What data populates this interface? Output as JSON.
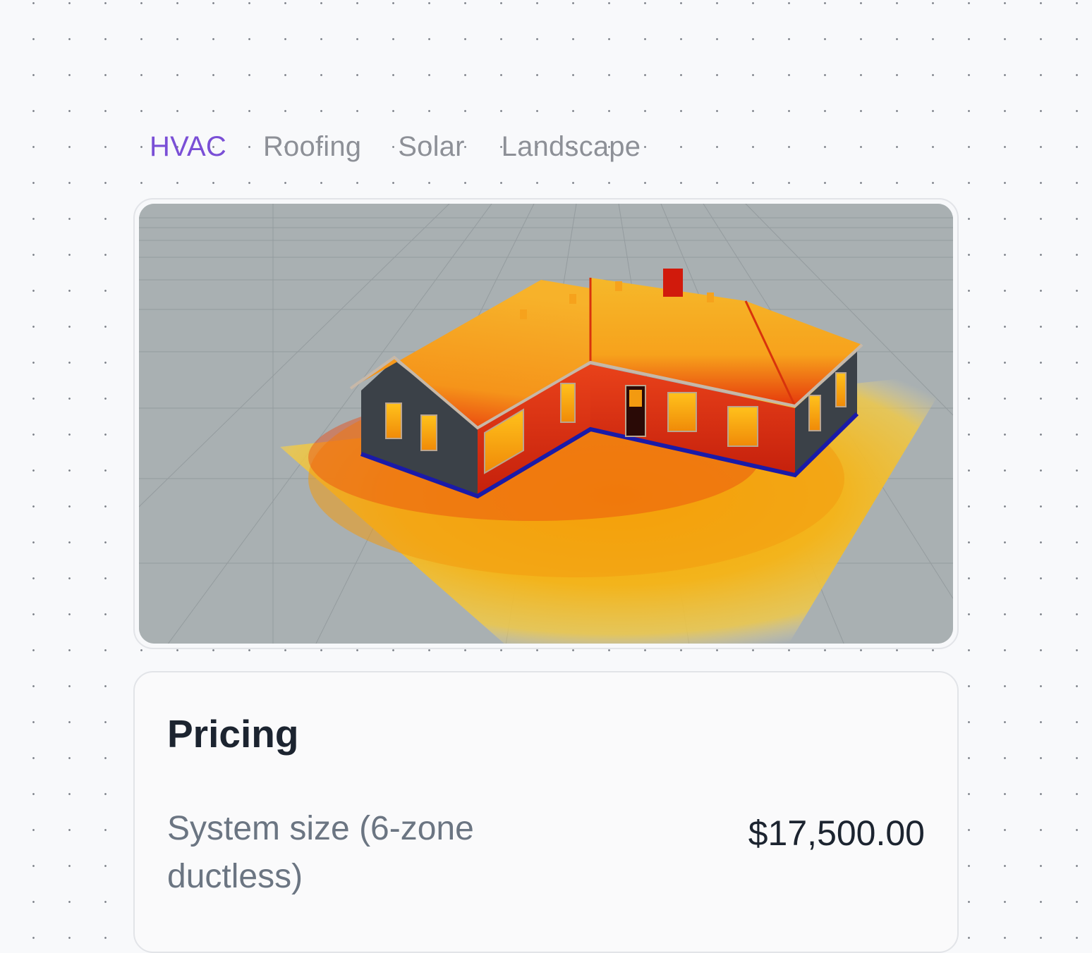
{
  "tabs": [
    {
      "label": "HVAC",
      "active": true
    },
    {
      "label": "Roofing",
      "active": false
    },
    {
      "label": "Solar",
      "active": false
    },
    {
      "label": "Landscape",
      "active": false
    }
  ],
  "colors": {
    "active_tab": "#7a4fd6",
    "inactive_tab": "#8d9097",
    "heat_hot": "#d8230f",
    "heat_warm": "#f4a000",
    "heat_cool": "#f2c82a",
    "ground": "#a9b0b2",
    "foundation": "#1a1aa8"
  },
  "viewer": {
    "content": "3d-house-heatmap"
  },
  "pricing": {
    "title": "Pricing",
    "items": [
      {
        "label": "System size (6-zone ductless)",
        "value": "$17,500.00"
      }
    ]
  }
}
